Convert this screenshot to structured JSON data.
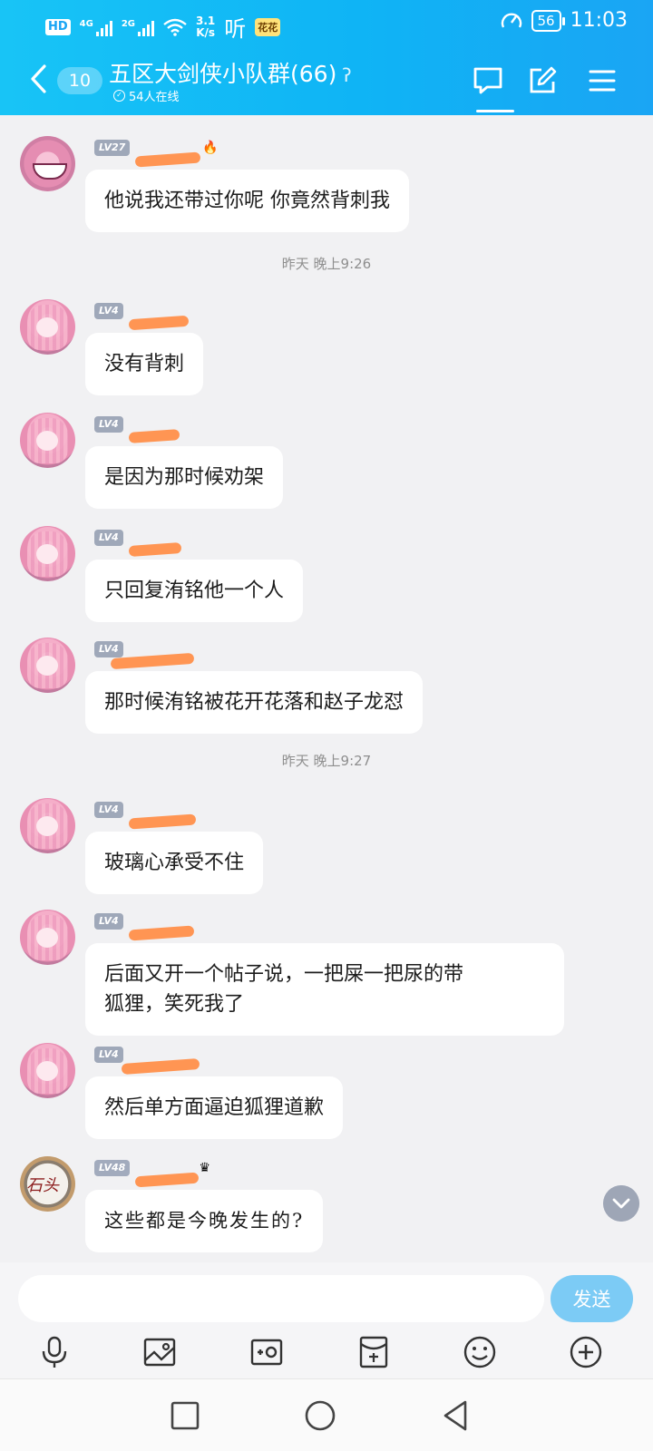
{
  "status_bar": {
    "hd": "HD",
    "sig1": "4G",
    "sig2": "2G",
    "speed_top": "3.1",
    "speed_bottom": "K/s",
    "ting": "听",
    "flower": "花花",
    "battery": "56",
    "time": "11:03"
  },
  "header": {
    "unread_count": "10",
    "title": "五区大剑侠小队群(66)",
    "online": "54人在线"
  },
  "messages": [
    {
      "level": "LV27",
      "text": "他说我还带过你呢 你竟然背刺我"
    },
    {
      "level": "LV4",
      "text": "没有背刺"
    },
    {
      "level": "LV4",
      "text": "是因为那时候劝架"
    },
    {
      "level": "LV4",
      "text": "只回复洧铭他一个人"
    },
    {
      "level": "LV4",
      "text": "那时候洧铭被花开花落和赵子龙怼"
    },
    {
      "level": "LV4",
      "text": "玻璃心承受不住"
    },
    {
      "level": "LV4",
      "text_line1": "后面又开一个帖子说，一把屎一把尿的带",
      "text_line2": "狐狸，笑死我了"
    },
    {
      "level": "LV4",
      "text": "然后单方面逼迫狐狸道歉"
    },
    {
      "level": "LV48",
      "avatar_text": "石头",
      "text": "这些都是今晚发生的?"
    }
  ],
  "timestamps": [
    "昨天 晚上9:26",
    "昨天 晚上9:27"
  ],
  "input": {
    "placeholder": "",
    "send_label": "发送"
  },
  "colors": {
    "header_gradient_start": "#18c4f6",
    "header_gradient_end": "#1aa5f4",
    "send_button": "#7ccbf5",
    "redaction": "#ff8f4a"
  }
}
